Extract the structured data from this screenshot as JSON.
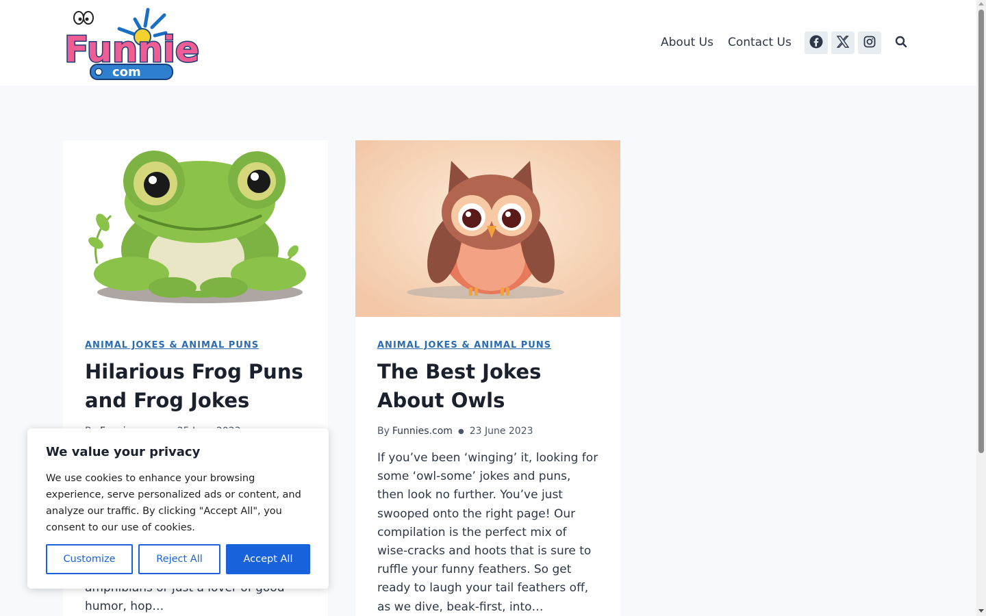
{
  "header": {
    "logo_alt": "Funnies.com",
    "logo_text": "Funnies",
    "logo_sub": "com",
    "nav": [
      {
        "label": "About Us"
      },
      {
        "label": "Contact Us"
      }
    ],
    "social": [
      "facebook-icon",
      "x-icon",
      "instagram-icon"
    ]
  },
  "posts": [
    {
      "category": "ANIMAL JOKES & ANIMAL PUNS",
      "title": "Hilarious Frog Puns and Frog Jokes",
      "by": "By",
      "author": "Funnies.com",
      "date": "25 June 2023",
      "excerpt": "amphibians or just a lover of good humor, hop…"
    },
    {
      "category": "ANIMAL JOKES & ANIMAL PUNS",
      "title": "The Best Jokes About Owls",
      "by": "By",
      "author": "Funnies.com",
      "date": "23 June 2023",
      "excerpt": "If you’ve been ‘winging’ it, looking for some ‘owl-some’ jokes and puns, then look no further. You’ve just swooped onto the right page! Our compilation is the perfect mix of wise-cracks and hoots that is sure to ruffle your funny feathers. So get ready to laugh your tail feathers off, as we dive, beak-first, into…"
    }
  ],
  "cookie": {
    "title": "We value your privacy",
    "text": "We use cookies to enhance your browsing experience, serve personalized ads or content, and analyze our traffic. By clicking \"Accept All\", you consent to our use of cookies.",
    "customize": "Customize",
    "reject": "Reject All",
    "accept": "Accept All"
  },
  "colors": {
    "accent": "#2b6cb0",
    "cookie_button": "#1863dc",
    "page_bg": "#f7f9fc"
  }
}
